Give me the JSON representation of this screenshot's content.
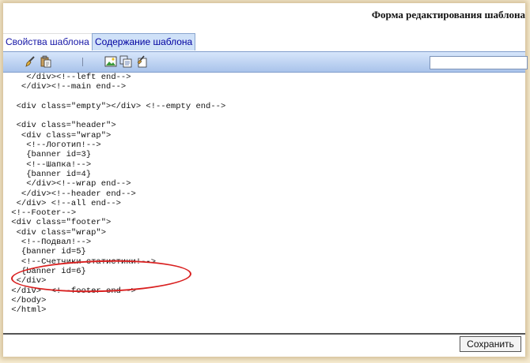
{
  "form": {
    "title": "Форма редактирования шаблона"
  },
  "tabs": [
    {
      "label": "Свойства шаблона",
      "active": false
    },
    {
      "label": "Содержание шаблона",
      "active": true
    }
  ],
  "toolbar": {
    "icons": [
      "brush-icon",
      "paste-icon",
      "image-icon",
      "copy-icon",
      "format-icon"
    ],
    "separator": "|",
    "search_value": ""
  },
  "editor": {
    "lines": [
      "    </div><!--left end-->",
      "   </div><!--main end-->",
      "",
      "  <div class=\"empty\"></div> <!--empty end-->",
      "",
      "  <div class=\"header\">",
      "   <div class=\"wrap\">",
      "    <!--Логотип!-->",
      "    {banner id=3}",
      "    <!--Шапка!-->",
      "    {banner id=4}",
      "    </div><!--wrap end-->",
      "   </div><!--header end-->",
      "  </div> <!--all end-->",
      " <!--Footer-->",
      " <div class=\"footer\">",
      "  <div class=\"wrap\">",
      "   <!--Подвал!-->",
      "   {banner id=5}",
      "   <!--Счетчики статистики!-->",
      "   {banner id=6}",
      "  </div>",
      " </div>  <!--footer end-->",
      " </body>",
      " </html>"
    ]
  },
  "annotation": {
    "color": "#d92020"
  },
  "buttons": {
    "save": "Сохранить"
  }
}
